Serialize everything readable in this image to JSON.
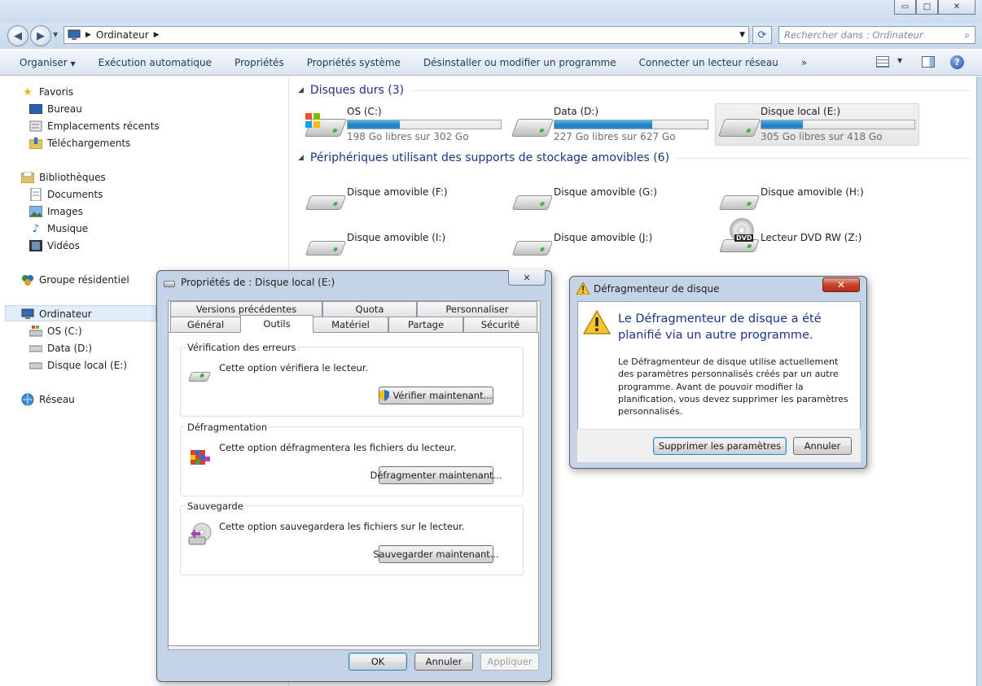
{
  "window": {
    "minimize_glyph": "▭",
    "maximize_glyph": "□",
    "close_glyph": "✕"
  },
  "address": {
    "path_root_icon": "computer-icon",
    "path": "Ordinateur",
    "search_placeholder": "Rechercher dans : Ordinateur"
  },
  "toolbar": {
    "organize": "Organiser",
    "autoplay": "Exécution automatique",
    "properties": "Propriétés",
    "system_properties": "Propriétés système",
    "uninstall": "Désinstaller ou modifier un programme",
    "map_drive": "Connecter un lecteur réseau",
    "more": "»"
  },
  "nav": {
    "favorites": "Favoris",
    "desktop": "Bureau",
    "recent": "Emplacements récents",
    "downloads": "Téléchargements",
    "libraries": "Bibliothèques",
    "documents": "Documents",
    "images": "Images",
    "music": "Musique",
    "videos": "Vidéos",
    "homegroup": "Groupe résidentiel",
    "computer": "Ordinateur",
    "os_c": "OS (C:)",
    "data_d": "Data (D:)",
    "local_e": "Disque local (E:)",
    "network": "Réseau"
  },
  "hard_disks": {
    "title": "Disques durs (3)",
    "drives": [
      {
        "name": "OS (C:)",
        "free": "198 Go libres sur 302 Go",
        "used_fraction": 0.34
      },
      {
        "name": "Data (D:)",
        "free": "227 Go libres sur 627 Go",
        "used_fraction": 0.64
      },
      {
        "name": "Disque local (E:)",
        "free": "305 Go libres sur 418 Go",
        "used_fraction": 0.27
      }
    ]
  },
  "removable": {
    "title": "Périphériques utilisant des supports de stockage amovibles (6)",
    "drives": [
      {
        "name": "Disque amovible (F:)"
      },
      {
        "name": "Disque amovible (G:)"
      },
      {
        "name": "Disque amovible (H:)"
      },
      {
        "name": "Disque amovible (I:)"
      },
      {
        "name": "Disque amovible (J:)"
      },
      {
        "name": "Lecteur DVD RW (Z:)",
        "badge": "DVD"
      }
    ]
  },
  "props_dialog": {
    "title": "Propriétés de : Disque local (E:)",
    "tabs_row1": [
      "Versions précédentes",
      "Quota",
      "Personnaliser"
    ],
    "tabs_row2": [
      "Général",
      "Outils",
      "Matériel",
      "Partage",
      "Sécurité"
    ],
    "check_group": "Vérification des erreurs",
    "check_text": "Cette option vérifiera le lecteur.",
    "check_button": "Vérifier maintenant...",
    "defrag_group": "Défragmentation",
    "defrag_text": "Cette option défragmentera les fichiers du lecteur.",
    "defrag_button": "Défragmenter maintenant...",
    "backup_group": "Sauvegarde",
    "backup_text": "Cette option sauvegardera les fichiers sur le lecteur.",
    "backup_button": "Sauvegarder maintenant...",
    "ok": "OK",
    "cancel": "Annuler",
    "apply": "Appliquer"
  },
  "defrag_dialog": {
    "title": "Défragmenteur de disque",
    "heading": "Le Défragmenteur de disque a été planifié via un autre programme.",
    "body": "Le Défragmenteur de disque utilise actuellement des paramètres personnalisés créés par un autre programme. Avant de pouvoir modifier la planification, vous devez supprimer les paramètres personnalisés.",
    "remove_button": "Supprimer les paramètres",
    "cancel_button": "Annuler"
  },
  "colors": {
    "link_blue": "#1e3287",
    "bar_fill": "#2a8dcc",
    "window_frame": "#c4d3e6"
  }
}
